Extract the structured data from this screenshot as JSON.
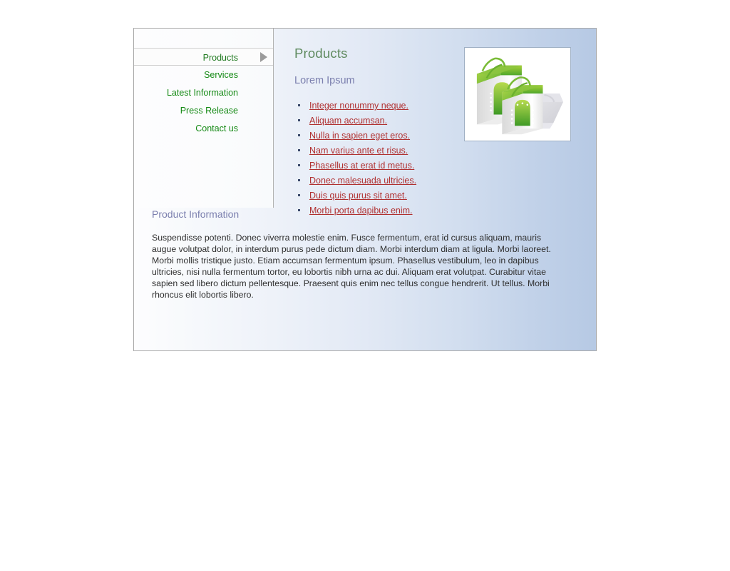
{
  "sidebar": {
    "items": [
      {
        "label": "Products",
        "active": true
      },
      {
        "label": "Services",
        "active": false
      },
      {
        "label": "Latest Information",
        "active": false
      },
      {
        "label": "Press Release",
        "active": false
      },
      {
        "label": "Contact us",
        "active": false
      }
    ],
    "active_arrow_icon": "triangle-right-icon"
  },
  "main": {
    "title": "Products",
    "subtitle": "Lorem Ipsum",
    "links": [
      "Integer nonummy neque.",
      "Aliquam accumsan.",
      "Nulla in sapien eget eros.",
      "Nam varius ante et risus.",
      "Phasellus at erat id metus.",
      "Donec malesuada ultricies.",
      "Duis quis purus sit amet.",
      "Morbi porta dapibus enim."
    ],
    "figure": {
      "alt": "shopping-bags-illustration"
    }
  },
  "section": {
    "title": "Product Information",
    "paragraph": "Suspendisse potenti. Donec viverra molestie enim. Fusce fermentum, erat id cursus aliquam, mauris augue volutpat dolor, in interdum purus pede dictum diam. Morbi interdum diam at ligula. Morbi laoreet. Morbi mollis tristique justo. Etiam accumsan fermentum ipsum. Phasellus vestibulum, leo in dapibus ultricies, nisi nulla fermentum tortor, eu lobortis nibh urna ac dui. Aliquam erat volutpat. Curabitur vitae sapien sed libero dictum pellentesque. Praesent quis enim nec tellus congue hendrerit. Ut tellus. Morbi rhoncus elit lobortis libero."
  },
  "colors": {
    "menu_link": "#168a16",
    "title": "#5f8a5f",
    "subtitle": "#7b7fae",
    "content_link": "#b03030",
    "frame_border": "#a8a8a8",
    "gradient_start": "#fdfdfe",
    "gradient_end": "#b6c9e4",
    "bag_green": "#7fc241",
    "bag_green_dark": "#4ba32c"
  }
}
